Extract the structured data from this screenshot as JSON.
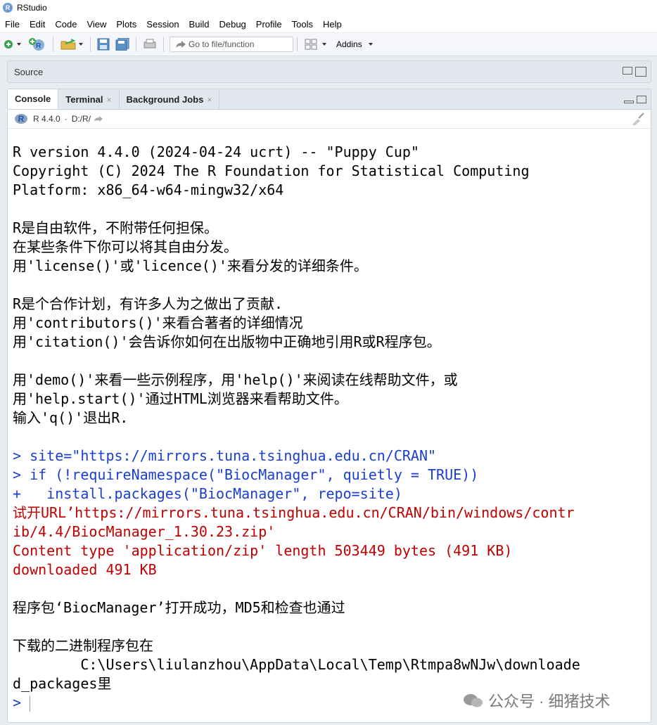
{
  "window": {
    "title": "RStudio"
  },
  "menu": [
    "File",
    "Edit",
    "Code",
    "View",
    "Plots",
    "Session",
    "Build",
    "Debug",
    "Profile",
    "Tools",
    "Help"
  ],
  "toolbar": {
    "goto_placeholder": "Go to file/function",
    "addins_label": "Addins"
  },
  "source_pane": {
    "label": "Source"
  },
  "console_tabs": [
    {
      "label": "Console",
      "closable": false
    },
    {
      "label": "Terminal",
      "closable": true
    },
    {
      "label": "Background Jobs",
      "closable": true
    }
  ],
  "console_info": {
    "r_version": "R 4.4.0",
    "sep": "·",
    "path": "D:/R/"
  },
  "console_lines": [
    {
      "text": "R version 4.4.0 (2024-04-24 ucrt) -- \"Puppy Cup\"",
      "style": "plain"
    },
    {
      "text": "Copyright (C) 2024 The R Foundation for Statistical Computing",
      "style": "plain"
    },
    {
      "text": "Platform: x86_64-w64-mingw32/x64",
      "style": "plain"
    },
    {
      "text": "",
      "style": "plain"
    },
    {
      "text": "R是自由软件，不附带任何担保。",
      "style": "plain"
    },
    {
      "text": "在某些条件下你可以将其自由分发。",
      "style": "plain"
    },
    {
      "text": "用'license()'或'licence()'来看分发的详细条件。",
      "style": "plain"
    },
    {
      "text": "",
      "style": "plain"
    },
    {
      "text": "R是个合作计划，有许多人为之做出了贡献.",
      "style": "plain"
    },
    {
      "text": "用'contributors()'来看合著者的详细情况",
      "style": "plain"
    },
    {
      "text": "用'citation()'会告诉你如何在出版物中正确地引用R或R程序包。",
      "style": "plain"
    },
    {
      "text": "",
      "style": "plain"
    },
    {
      "text": "用'demo()'来看一些示例程序，用'help()'来阅读在线帮助文件，或",
      "style": "plain"
    },
    {
      "text": "用'help.start()'通过HTML浏览器来看帮助文件。",
      "style": "plain"
    },
    {
      "text": "输入'q()'退出R.",
      "style": "plain"
    },
    {
      "text": "",
      "style": "plain"
    },
    {
      "text": "> site=\"https://mirrors.tuna.tsinghua.edu.cn/CRAN\"",
      "style": "blue"
    },
    {
      "text": "> if (!requireNamespace(\"BiocManager\", quietly = TRUE))",
      "style": "blue"
    },
    {
      "text": "+   install.packages(\"BiocManager\", repo=site)",
      "style": "blue"
    },
    {
      "text": "试开URL’https://mirrors.tuna.tsinghua.edu.cn/CRAN/bin/windows/contr",
      "style": "red"
    },
    {
      "text": "ib/4.4/BiocManager_1.30.23.zip'",
      "style": "red"
    },
    {
      "text": "Content type 'application/zip' length 503449 bytes (491 KB)",
      "style": "red"
    },
    {
      "text": "downloaded 491 KB",
      "style": "red"
    },
    {
      "text": "",
      "style": "plain"
    },
    {
      "text": "程序包‘BiocManager’打开成功，MD5和检查也通过",
      "style": "plain"
    },
    {
      "text": "",
      "style": "plain"
    },
    {
      "text": "下载的二进制程序包在",
      "style": "plain"
    },
    {
      "text": "        C:\\Users\\liulanzhou\\AppData\\Local\\Temp\\Rtmpa8wNJw\\downloade",
      "style": "plain"
    },
    {
      "text": "d_packages里",
      "style": "plain"
    },
    {
      "text": "> ",
      "style": "blue"
    }
  ],
  "watermark": {
    "text": "公众号 · 细猪技术"
  }
}
